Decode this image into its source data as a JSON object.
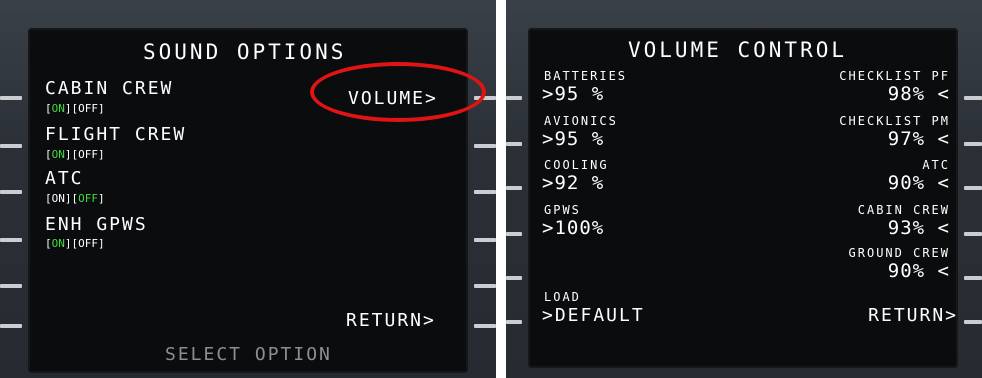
{
  "sound_options": {
    "title": "SOUND OPTIONS",
    "items": [
      {
        "label": "CABIN CREW",
        "on": "ON",
        "off": "OFF",
        "active": "on"
      },
      {
        "label": "FLIGHT CREW",
        "on": "ON",
        "off": "OFF",
        "active": "on"
      },
      {
        "label": "ATC",
        "on": "ON",
        "off": "OFF",
        "active": "off"
      },
      {
        "label": "ENH GPWS",
        "on": "ON",
        "off": "OFF",
        "active": "on"
      }
    ],
    "volume_button": "VOLUME>",
    "return_button": "RETURN>",
    "scratchpad": "SELECT OPTION"
  },
  "volume_control": {
    "title": "VOLUME CONTROL",
    "left": [
      {
        "label": "BATTERIES",
        "value": ">95 %"
      },
      {
        "label": "AVIONICS",
        "value": ">95 %"
      },
      {
        "label": "COOLING",
        "value": ">92 %"
      },
      {
        "label": "GPWS",
        "value": ">100%"
      }
    ],
    "right": [
      {
        "label": "CHECKLIST PF",
        "value": "98% <"
      },
      {
        "label": "CHECKLIST PM",
        "value": "97% <"
      },
      {
        "label": "ATC",
        "value": "90% <"
      },
      {
        "label": "CABIN CREW",
        "value": "93% <"
      },
      {
        "label": "GROUND CREW",
        "value": "90% <"
      }
    ],
    "load_label": "LOAD",
    "default_button": ">DEFAULT",
    "return_button": "RETURN>"
  },
  "colors": {
    "on_active": "#3ddc3d",
    "highlight_circle": "#e11414"
  }
}
